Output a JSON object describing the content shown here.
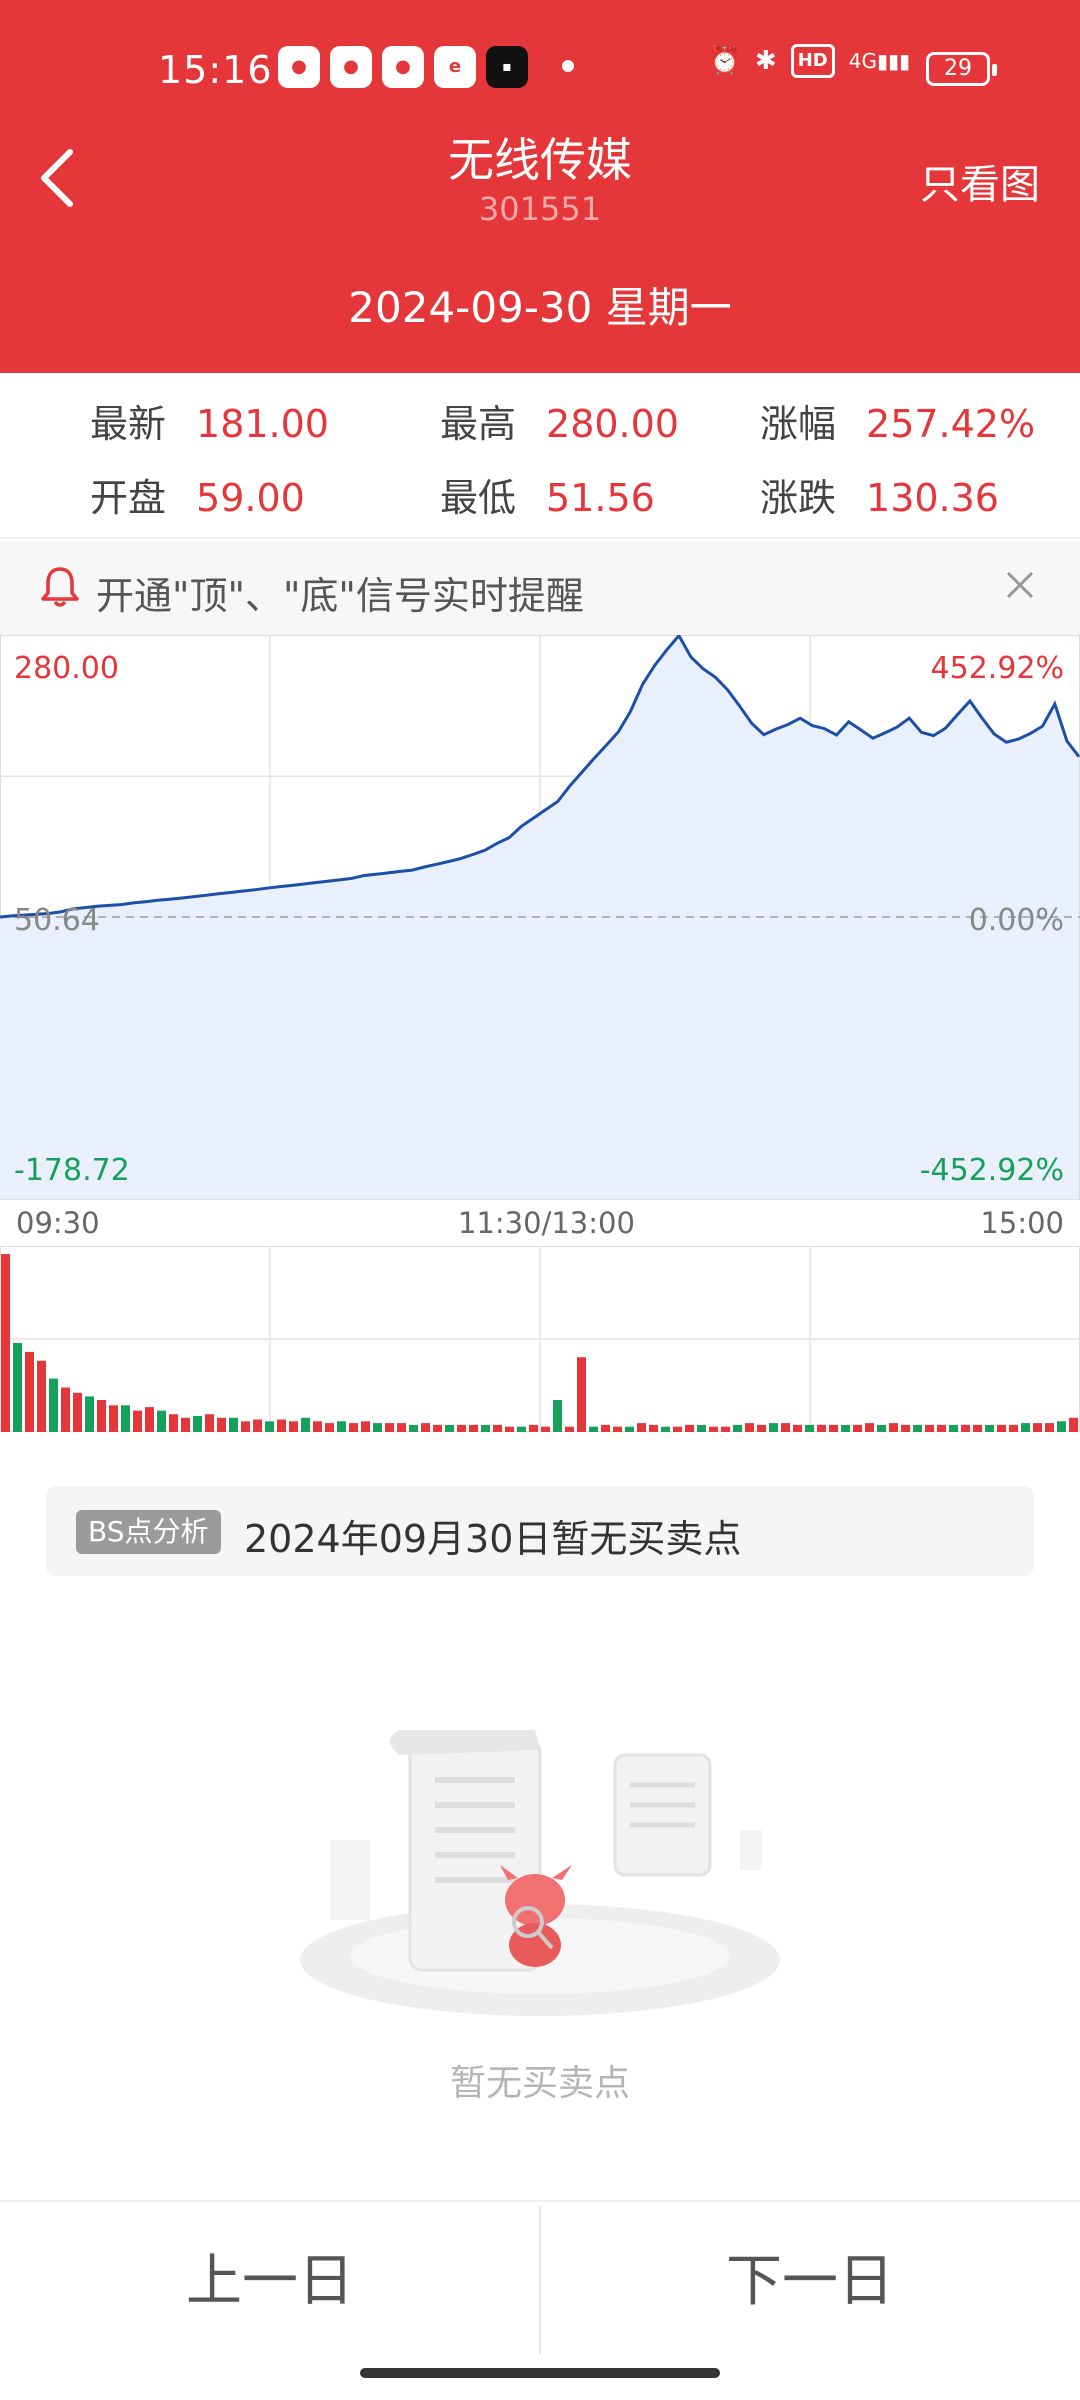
{
  "status": {
    "time": "15:16",
    "battery": "29",
    "hd": "HD",
    "net": "4G"
  },
  "header": {
    "title": "无线传媒",
    "code": "301551",
    "right_button": "只看图",
    "date": "2024-09-30 星期一",
    "bg_color": "#e5363a"
  },
  "quote": {
    "items": [
      {
        "label": "最新",
        "value": "181.00"
      },
      {
        "label": "最高",
        "value": "280.00"
      },
      {
        "label": "涨幅",
        "value": "257.42%"
      },
      {
        "label": "开盘",
        "value": "59.00"
      },
      {
        "label": "最低",
        "value": "51.56"
      },
      {
        "label": "涨跌",
        "value": "130.36"
      }
    ]
  },
  "alert": {
    "text": "开通\"顶\"、\"底\"信号实时提醒"
  },
  "chart": {
    "y_top_left": "280.00",
    "y_mid_left": "50.64",
    "y_bottom_left": "-178.72",
    "y_top_right": "452.92%",
    "y_mid_right": "0.00%",
    "y_bottom_right": "-452.92%",
    "time_start": "09:30",
    "time_mid": "11:30/13:00",
    "time_end": "15:00"
  },
  "chart_data": {
    "type": "line",
    "title": "",
    "xlabel": "",
    "ylabel": "",
    "x_ticks": [
      "09:30",
      "11:30/13:00",
      "15:00"
    ],
    "ylim": [
      -178.72,
      280.0
    ],
    "reference_price": 50.64,
    "series": [
      {
        "name": "",
        "values": [
          50.6,
          51.5,
          52.2,
          52.8,
          53.5,
          54.8,
          57.2,
          58.3,
          59.4,
          60.1,
          60.7,
          62.1,
          63.1,
          64.2,
          65.0,
          66.1,
          67.2,
          68.3,
          69.5,
          70.6,
          71.7,
          72.8,
          74.1,
          75.2,
          76.3,
          77.4,
          78.6,
          79.7,
          80.8,
          82.0,
          84.3,
          85.4,
          86.5,
          87.7,
          88.8,
          91.3,
          93.5,
          95.8,
          98.1,
          101.5,
          104.9,
          110.6,
          115.2,
          124.3,
          131.1,
          137.8,
          144.6,
          157.2,
          168.3,
          179.6,
          190.2,
          201.2,
          217.7,
          239.9,
          255.2,
          268.0,
          279.5,
          262.0,
          252.5,
          245.7,
          235.6,
          222.3,
          208.2,
          198.9,
          203.5,
          207.2,
          212.3,
          206.3,
          203.9,
          198.7,
          209.4,
          202.8,
          196.1,
          200.4,
          205.1,
          212.4,
          200.9,
          198.2,
          204.3,
          215.6,
          226.3,
          212.5,
          199.6,
          192.8,
          195.3,
          200.0,
          205.9,
          224.0,
          193.8,
          181.0
        ]
      }
    ],
    "volume": {
      "name": "",
      "values": [
        100,
        50,
        45,
        40,
        30,
        25,
        22,
        20,
        18,
        15,
        15,
        12,
        14,
        12,
        10,
        8,
        9,
        10,
        8,
        8,
        6,
        7,
        6,
        7,
        6,
        8,
        6,
        5,
        6,
        5,
        6,
        5,
        5,
        5,
        4,
        5,
        4,
        4,
        4,
        4,
        4,
        4,
        3,
        3,
        4,
        3,
        18,
        3,
        42,
        3,
        4,
        3,
        3,
        5,
        4,
        3,
        3,
        4,
        4,
        3,
        3,
        4,
        5,
        4,
        5,
        5,
        4,
        4,
        4,
        4,
        4,
        4,
        5,
        4,
        5,
        4,
        4,
        4,
        4,
        4,
        4,
        4,
        4,
        4,
        4,
        5,
        5,
        5,
        6,
        8
      ]
    }
  },
  "bs": {
    "tag": "BS点分析",
    "text": "2024年09月30日暂无买卖点"
  },
  "empty": {
    "text": "暂无买卖点"
  },
  "nav": {
    "prev": "上一日",
    "next": "下一日"
  }
}
